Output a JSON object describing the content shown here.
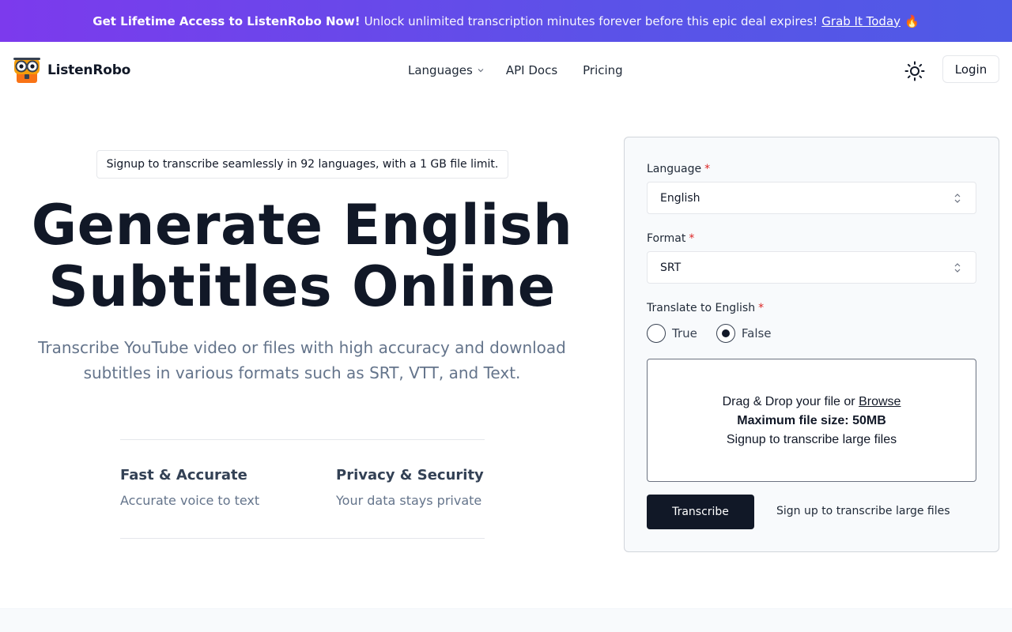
{
  "promo": {
    "headline": "Get Lifetime Access to ListenRobo Now!",
    "message": "Unlock unlimited transcription minutes forever before this epic deal expires!",
    "cta": "Grab It Today",
    "emoji": "🔥"
  },
  "header": {
    "brand": "ListenRobo",
    "nav": {
      "languages": "Languages",
      "api_docs": "API Docs",
      "pricing": "Pricing"
    },
    "theme_icon": "sun-icon",
    "login": "Login"
  },
  "hero": {
    "pill": "Signup to transcribe seamlessly in 92 languages, with a 1 GB file limit.",
    "title_line1": "Generate English",
    "title_line2": "Subtitles Online",
    "subtitle": "Transcribe YouTube video or files with high accuracy and download subtitles in various formats such as SRT, VTT, and Text.",
    "features": [
      {
        "title": "Fast & Accurate",
        "desc": "Accurate voice to text"
      },
      {
        "title": "Privacy & Security",
        "desc": "Your data stays private"
      }
    ]
  },
  "form": {
    "language_label": "Language",
    "language_value": "English",
    "format_label": "Format",
    "format_value": "SRT",
    "translate_label": "Translate to English",
    "required_mark": "*",
    "radio_true": "True",
    "radio_false": "False",
    "selected_option": "False",
    "dropzone": {
      "prefix": "Drag & Drop your file or",
      "browse": "Browse",
      "max_size": "Maximum file size: 50MB",
      "hint": "Signup to transcribe large files"
    },
    "submit": "Transcribe",
    "signup_link": "Sign up to transcribe large files"
  },
  "colors": {
    "banner_start": "#7c3aed",
    "banner_end": "#4f5ae6",
    "primary_button": "#111827",
    "required": "#dc2626"
  }
}
